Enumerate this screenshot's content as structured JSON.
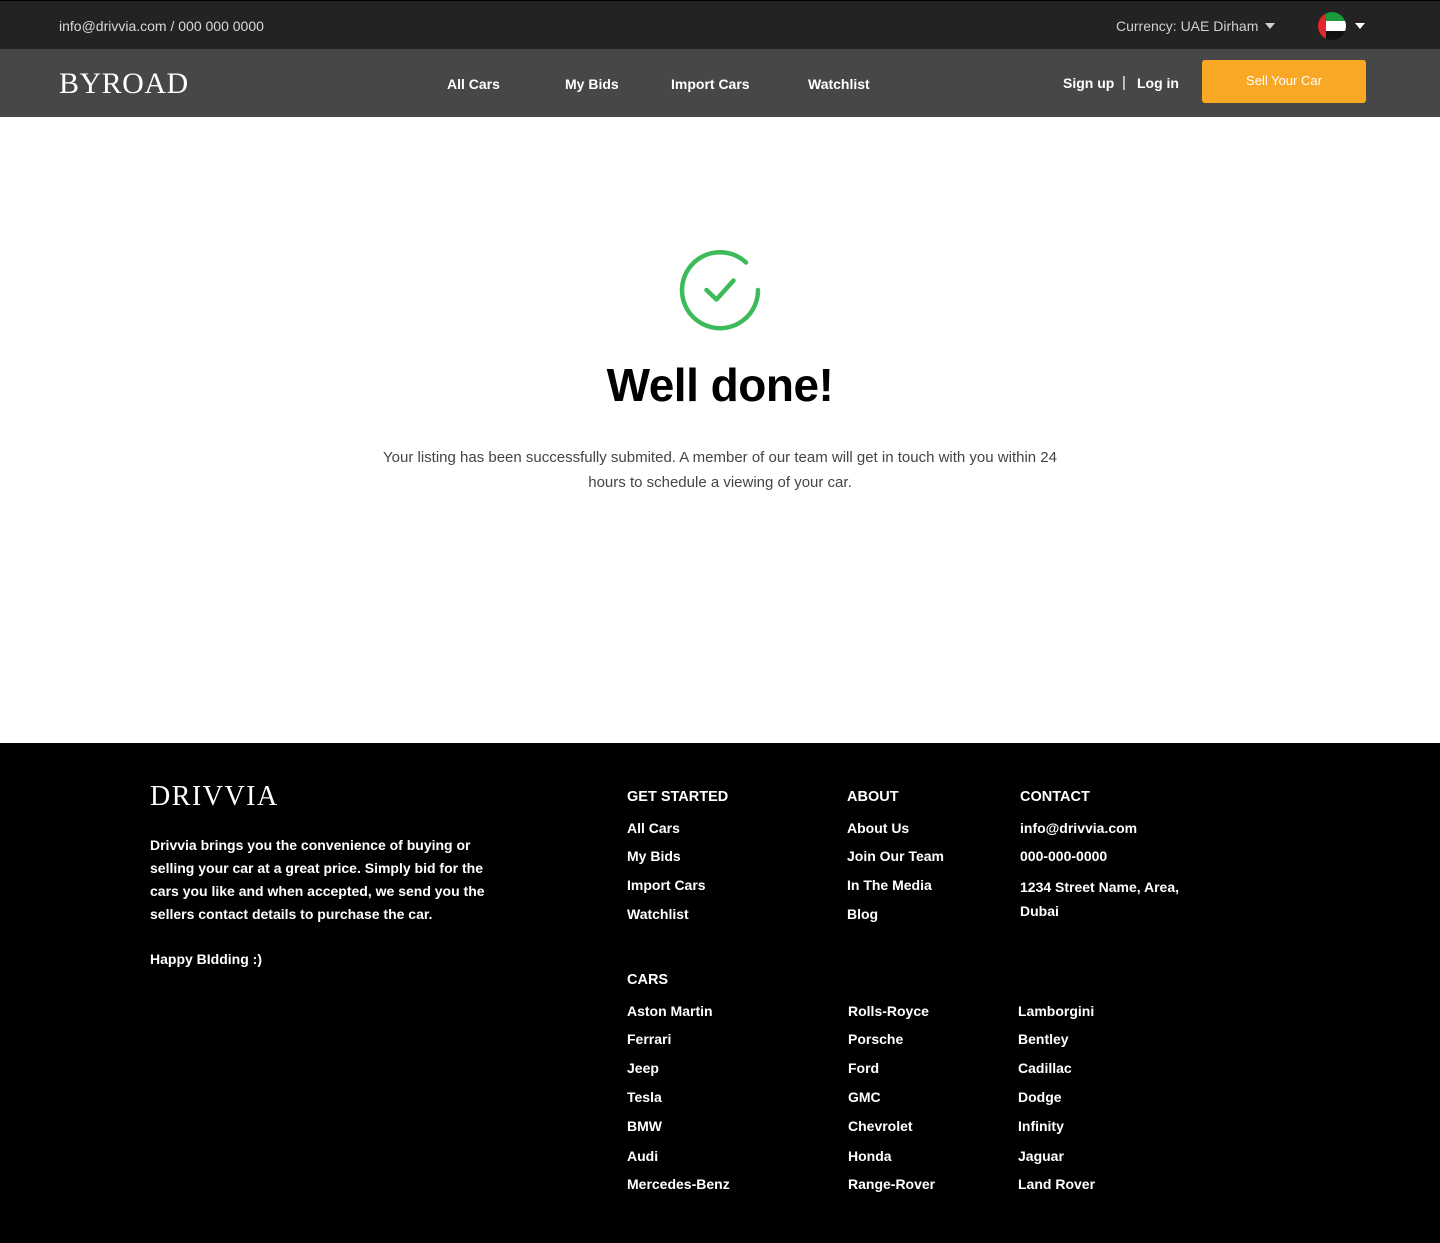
{
  "topbar": {
    "contact": "info@drivvia.com / 000 000 0000",
    "currency": "Currency: UAE Dirham",
    "flag": "uae-flag",
    "colors": {
      "background": "#232323"
    }
  },
  "nav": {
    "brand": "BYROAD",
    "links": [
      "All Cars",
      "My Bids",
      "Import Cars",
      "Watchlist"
    ],
    "sign_up": "Sign up",
    "separator": "|",
    "log_in": "Log in",
    "sell_button": "Sell Your Car",
    "colors": {
      "background": "#474747",
      "accent": "#f9a825"
    }
  },
  "main": {
    "icon": "check-circle-icon",
    "title": "Well done!",
    "message": "Your listing has been successfully submited. A member of our team will get in touch with you within 24 hours to schedule a viewing of your car.",
    "colors": {
      "success": "#3dba5a"
    }
  },
  "footer": {
    "brand": "DRIVVIA",
    "about_text": "Drivvia brings you the convenience of buying or selling your car at a great price. Simply bid for the cars you like and when accepted, we send you the sellers contact details to purchase the car.",
    "happy": "Happy BIdding :)",
    "get_started": {
      "heading": "GET STARTED",
      "links": [
        "All Cars",
        "My Bids",
        "Import Cars",
        "Watchlist"
      ]
    },
    "about": {
      "heading": "ABOUT",
      "links": [
        "About Us",
        "Join Our Team",
        "In The Media",
        "Blog"
      ]
    },
    "contact": {
      "heading": "CONTACT",
      "email": "info@drivvia.com",
      "phone": "000-000-0000",
      "address": "1234 Street Name, Area, Dubai"
    },
    "cars": {
      "heading": "CARS",
      "col1": [
        "Aston Martin",
        "Ferrari",
        "Jeep",
        "Tesla",
        "BMW",
        "Audi",
        "Mercedes-Benz"
      ],
      "col2": [
        "Rolls-Royce",
        "Porsche",
        "Ford",
        "GMC",
        "Chevrolet",
        "Honda",
        "Range-Rover"
      ],
      "col3": [
        "Lamborgini",
        "Bentley",
        "Cadillac",
        "Dodge",
        "Infinity",
        "Jaguar",
        "Land Rover"
      ]
    }
  }
}
